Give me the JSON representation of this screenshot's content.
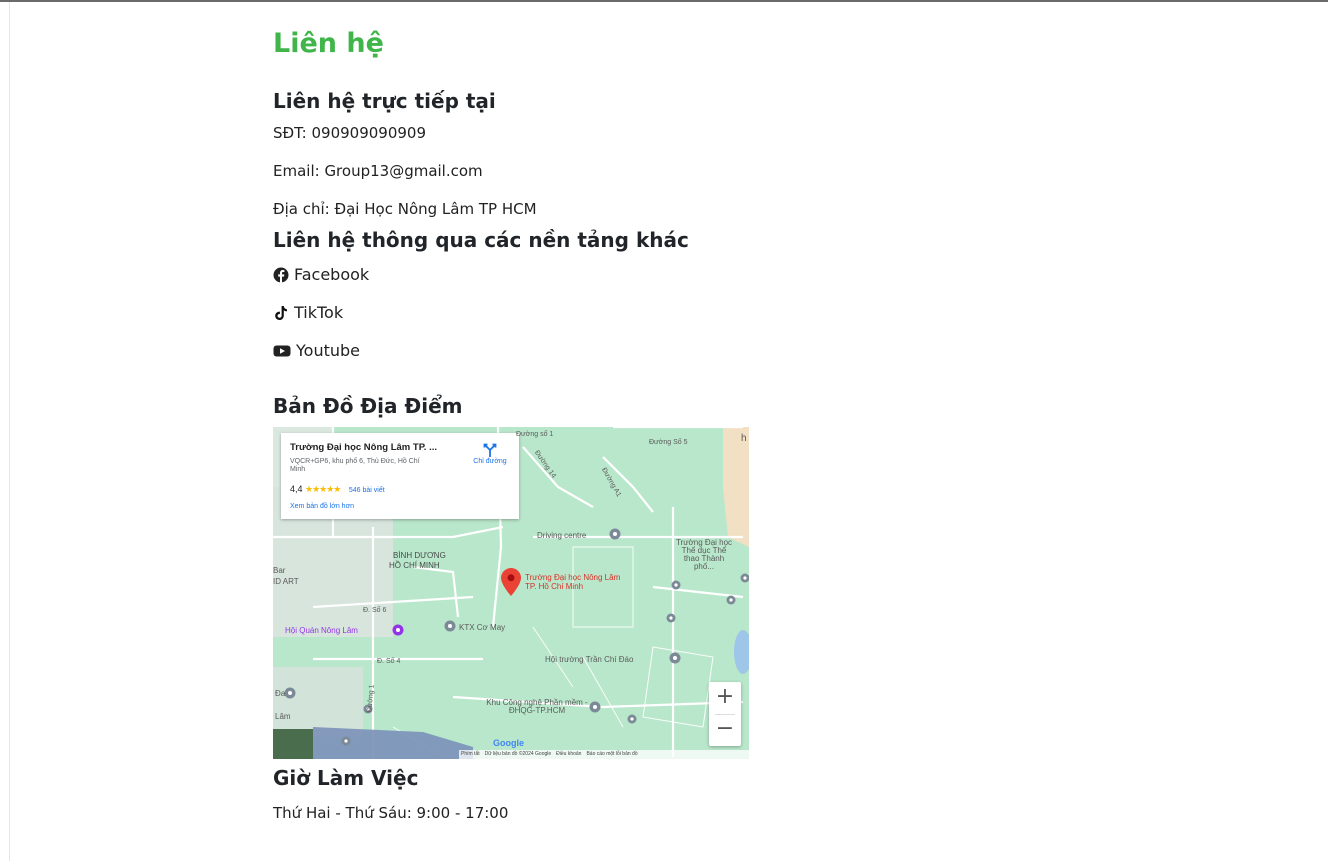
{
  "page": {
    "title": "Liên hệ"
  },
  "direct_contact": {
    "heading": "Liên hệ trực tiếp tại",
    "phone": "SĐT: 090909090909",
    "email": "Email: Group13@gmail.com",
    "address": "Địa chỉ: Đại Học Nông Lâm TP HCM"
  },
  "other_platforms": {
    "heading": "Liên hệ thông qua các nền tảng khác",
    "items": [
      {
        "label": "Facebook",
        "icon": "facebook-icon"
      },
      {
        "label": "TikTok",
        "icon": "tiktok-icon"
      },
      {
        "label": "Youtube",
        "icon": "youtube-icon"
      }
    ]
  },
  "map_section": {
    "heading": "Bản Đồ Địa Điểm",
    "card": {
      "title": "Trường Đại học Nông Lâm TP. ...",
      "address": "VQCR+GP6, khu phố 6, Thủ Đức, Hồ Chí Minh",
      "rating": "4,4",
      "stars": "★★★★★",
      "reviews": "546 bài viết",
      "larger_map": "Xem bản đồ lớn hơn",
      "directions": "Chỉ đường"
    },
    "labels": {
      "pin": "Trường Đại học Nông Lâm TP. Hồ Chí Minh",
      "driving_centre": "Driving centre",
      "sports": "Trường Đại học Thể dục Thể thao Thành phố...",
      "binh_duong": "BÌNH DƯƠNG",
      "ho_chi_minh": "HỒ CHÍ MINH",
      "bar": "Bar",
      "id_art": "ID ART",
      "hoi_quan": "Hội Quán Nông Lâm",
      "ktx": "KTX Cơ May",
      "hoi_truong": "Hội trường Trần Chí Đáo",
      "software_park": "Khu Công nghệ Phần mềm - ĐHQG-TP.HCM",
      "road_so5": "Đường Số 5",
      "road_so1": "Đường số 1",
      "road_14": "Đường 14",
      "road_a1": "Đường A1",
      "road_so4": "Đ. Số 4",
      "road_so6": "Đ. Số 6",
      "road_1": "Đường 1",
      "da": "Đa",
      "lam": "Lâm",
      "h": "h",
      "google": "Google"
    },
    "footer": {
      "shortcuts": "Phím tắt",
      "data": "Dữ liệu bản đồ ©2024 Google",
      "terms": "Điều khoản",
      "report": "Báo cáo một lỗi bản đồ"
    }
  },
  "hours": {
    "heading": "Giờ Làm Việc",
    "weekdays": "Thứ Hai - Thứ Sáu: 9:00 - 17:00"
  },
  "colors": {
    "title_green": "#3fb54a",
    "map_bg": "#b7e8cd",
    "pin_red": "#ea4335",
    "link_blue": "#1a73e8"
  }
}
